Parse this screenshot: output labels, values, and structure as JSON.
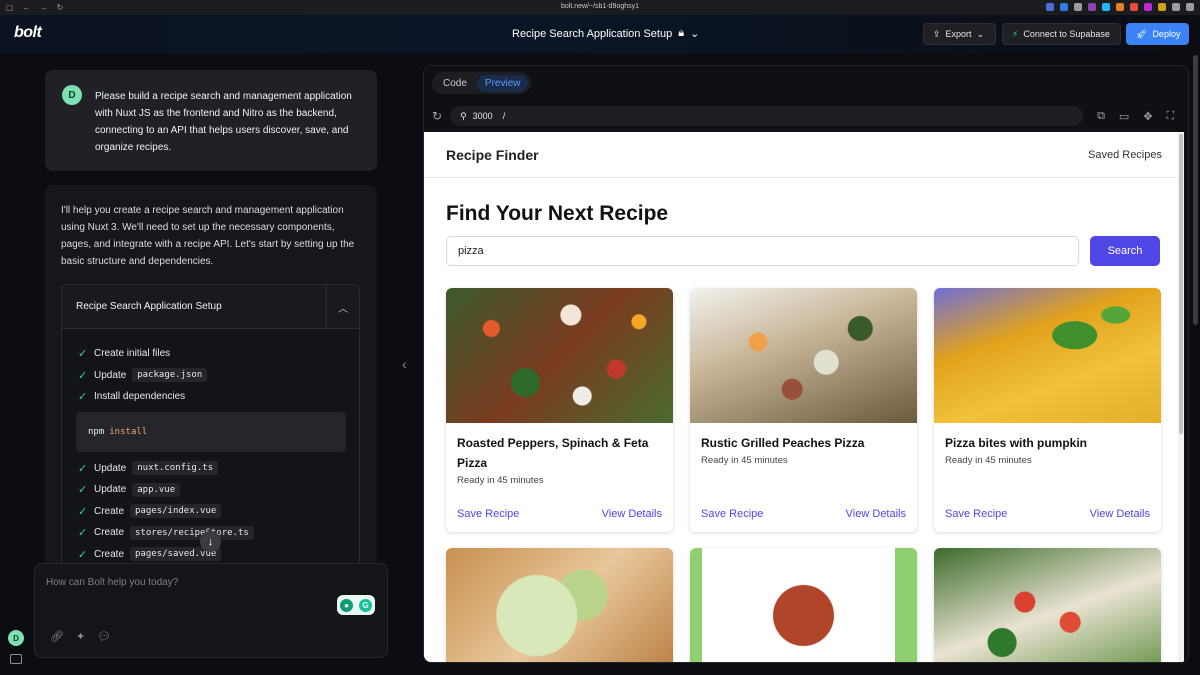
{
  "browser": {
    "url": "bolt.new/~/sb1-d9oghsy1",
    "extension_colors": [
      "#4f6bd8",
      "#2a7de1",
      "#9a9ca3",
      "#8e44ad",
      "#1fb6ff",
      "#e67e22",
      "#e74c3c",
      "#c026d3",
      "#d4a017",
      "#9a9ca3",
      "#9a9ca3"
    ]
  },
  "header": {
    "logo": "bolt",
    "project_title": "Recipe Search Application Setup",
    "export_label": "Export",
    "supabase_label": "Connect to Supabase",
    "deploy_label": "Deploy"
  },
  "chat": {
    "user_initial": "D",
    "user_message": "Please build a recipe search and management application with Nuxt JS as the frontend and Nitro as the backend, connecting to an API that helps users discover, save, and organize recipes.",
    "bot_message": "I'll help you create a recipe search and management application using Nuxt 3. We'll need to set up the necessary components, pages, and integrate with a recipe API. Let's start by setting up the basic structure and dependencies.",
    "artifact": {
      "title": "Recipe Search Application Setup",
      "steps": [
        {
          "action": "Create initial files",
          "file": ""
        },
        {
          "action": "Update",
          "file": "package.json"
        },
        {
          "action": "Install dependencies",
          "file": ""
        },
        {
          "action": "Update",
          "file": "nuxt.config.ts"
        },
        {
          "action": "Update",
          "file": "app.vue"
        },
        {
          "action": "Create",
          "file": "pages/index.vue"
        },
        {
          "action": "Create",
          "file": "stores/recipeStore.ts"
        },
        {
          "action": "Create",
          "file": "pages/saved.vue"
        }
      ],
      "command": {
        "bin": "npm",
        "arg": "install"
      }
    },
    "prompt_placeholder": "How can Bolt help you today?",
    "side_avatar": "D"
  },
  "workbench": {
    "tabs": [
      {
        "label": "Code",
        "active": false
      },
      {
        "label": "Preview",
        "active": true
      }
    ],
    "port": "3000",
    "path": "/"
  },
  "preview": {
    "brand": "Recipe Finder",
    "nav_link": "Saved Recipes",
    "heading": "Find Your Next Recipe",
    "search_value": "pizza",
    "search_button": "Search",
    "save_label": "Save Recipe",
    "details_label": "View Details",
    "recipes": [
      {
        "title": "Roasted Peppers, Spinach & Feta Pizza",
        "time": "Ready in 45 minutes"
      },
      {
        "title": "Rustic Grilled Peaches Pizza",
        "time": "Ready in 45 minutes"
      },
      {
        "title": "Pizza bites with pumpkin",
        "time": "Ready in 45 minutes"
      }
    ]
  },
  "colors": {
    "accent": "#3b82f6",
    "preview_accent": "#4f46e5",
    "check": "#34d399"
  }
}
